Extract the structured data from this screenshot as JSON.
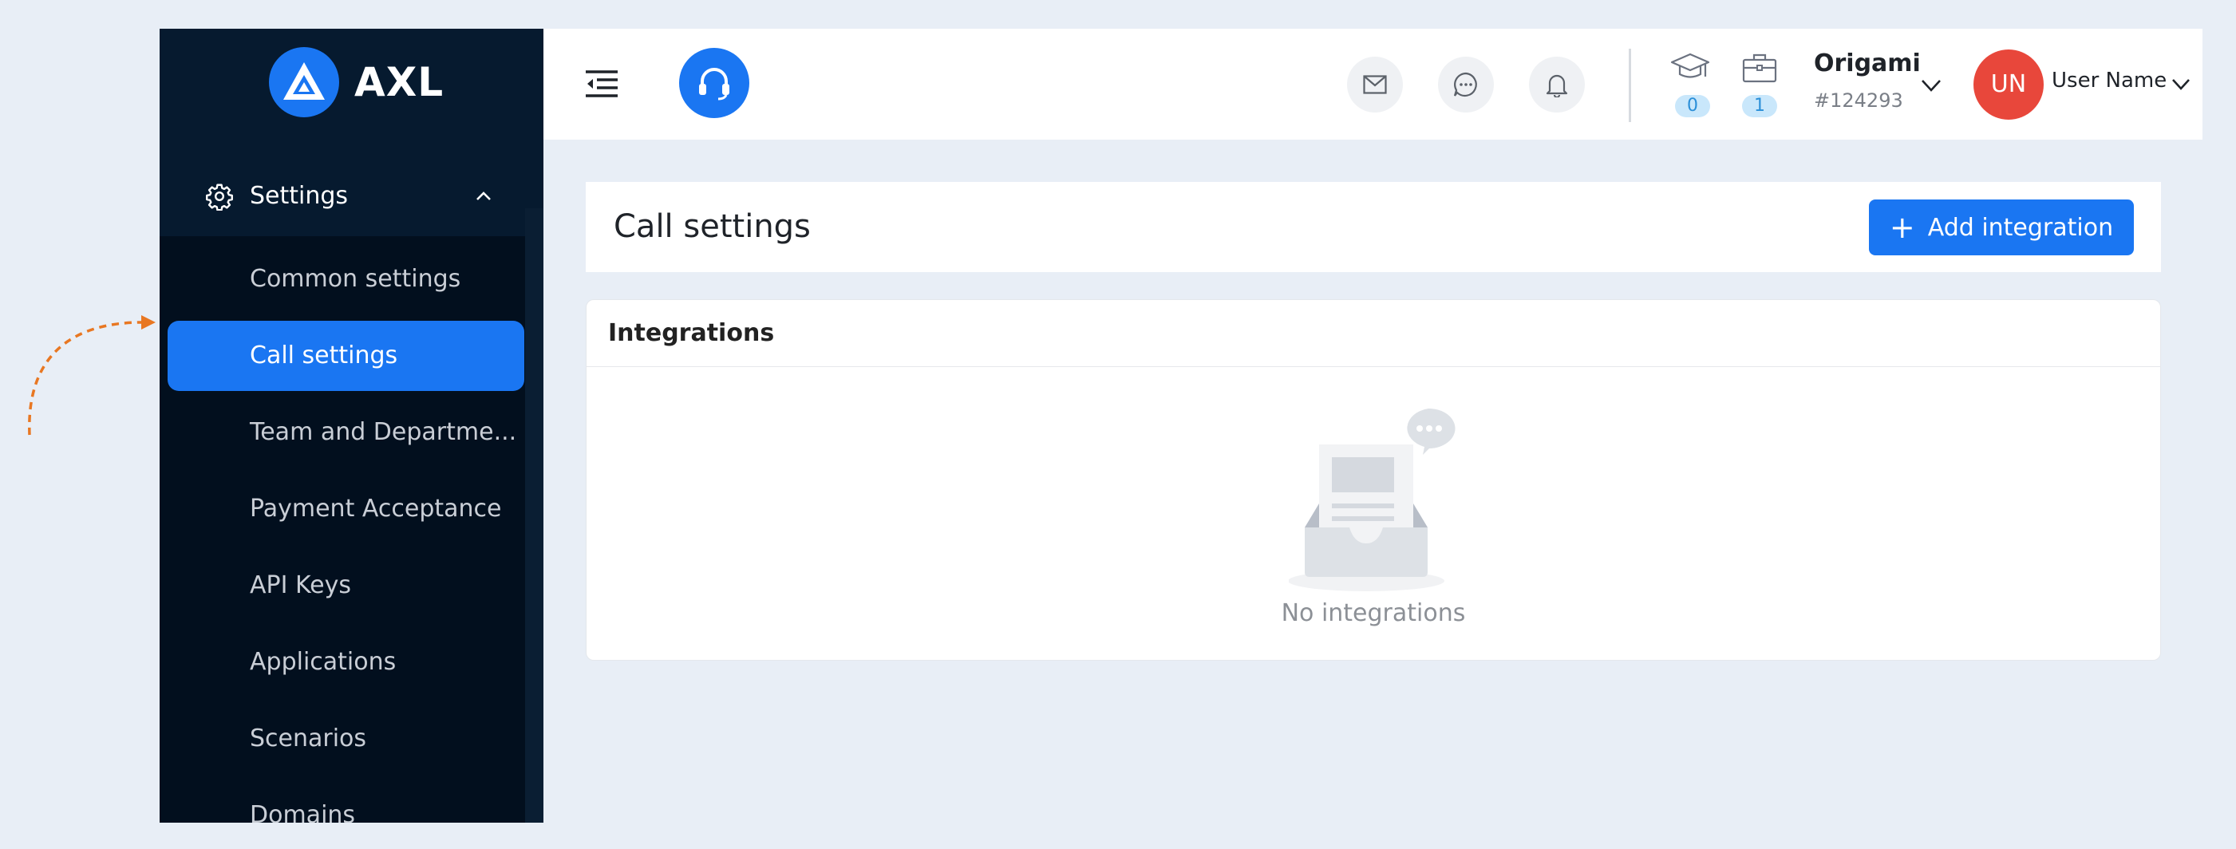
{
  "sidebar": {
    "brand": "AXL",
    "section": "Settings",
    "items": [
      {
        "label": "Common settings",
        "active": false
      },
      {
        "label": "Call settings",
        "active": true
      },
      {
        "label": "Team and Departme...",
        "active": false
      },
      {
        "label": "Payment Acceptance",
        "active": false
      },
      {
        "label": "API Keys",
        "active": false
      },
      {
        "label": "Applications",
        "active": false
      },
      {
        "label": "Scenarios",
        "active": false
      },
      {
        "label": "Domains",
        "active": false
      }
    ]
  },
  "topbar": {
    "icons": [
      "menu-collapse-icon",
      "headset-icon",
      "mail-icon",
      "chat-icon",
      "bell-icon",
      "graduation-cap-icon",
      "briefcase-icon"
    ],
    "badges": {
      "learning": "0",
      "cases": "1"
    },
    "company": {
      "name": "Origami",
      "id": "#124293"
    },
    "user": {
      "initials": "UN",
      "name": "User Name"
    }
  },
  "page": {
    "title": "Call settings",
    "add_button": "Add integration",
    "card_title": "Integrations",
    "empty_text": "No integrations"
  },
  "colors": {
    "accent": "#1a76f2",
    "sidebar_bg": "#061a2f",
    "page_bg": "#e8eef6",
    "avatar": "#e8473b",
    "annotation_arrow": "#e87722"
  }
}
